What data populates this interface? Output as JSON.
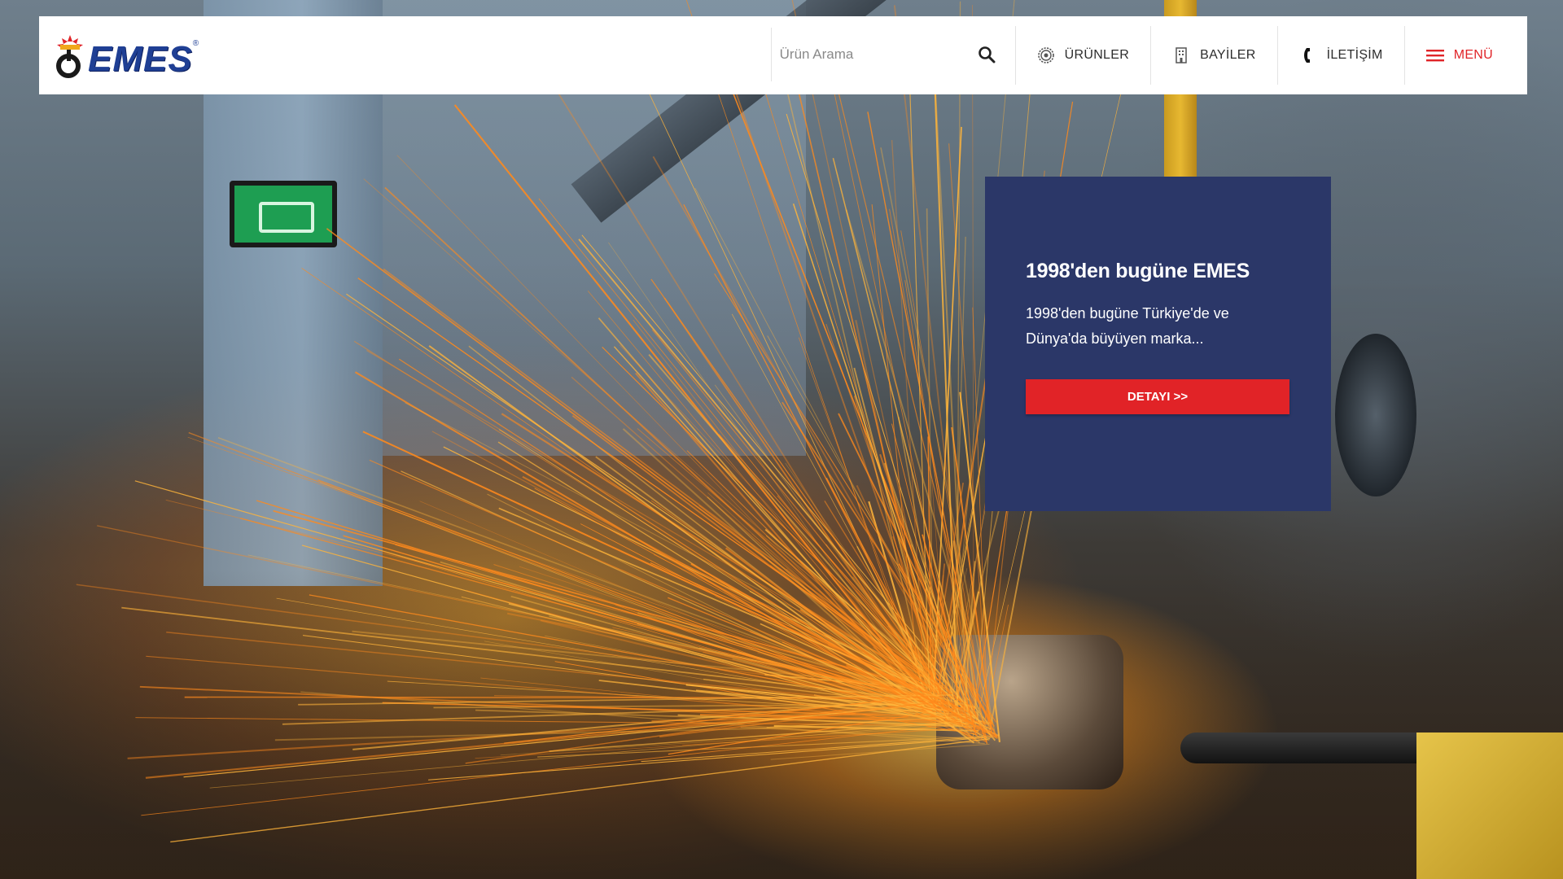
{
  "brand": {
    "name": "EMES",
    "registered_mark": "®",
    "colors": {
      "primary": "#1f3f94",
      "accent": "#e02428",
      "card": "#2b3768"
    }
  },
  "header": {
    "search": {
      "placeholder": "Ürün Arama",
      "value": "",
      "icon": "search-icon"
    },
    "nav": {
      "products": {
        "label": "ÜRÜNLER",
        "icon": "gear-icon"
      },
      "dealers": {
        "label": "BAYİLER",
        "icon": "building-icon"
      },
      "contact": {
        "label": "İLETİŞİM",
        "icon": "phone-icon"
      },
      "menu": {
        "label": "MENÜ",
        "icon": "hamburger-menu-icon"
      }
    }
  },
  "hero_card": {
    "title": "1998'den bugüne EMES",
    "text": "1998'den bugüne Türkiye'de ve Dünya'da büyüyen marka...",
    "button_label": "DETAYI >>"
  }
}
